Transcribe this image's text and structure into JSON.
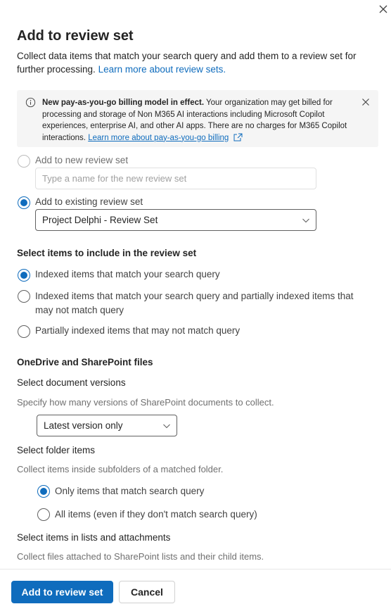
{
  "panel": {
    "title": "Add to review set",
    "description": "Collect data items that match your search query and add them to a review set for further processing.",
    "learn_more_link": "Learn more about review sets."
  },
  "banner": {
    "bold_text": "New pay-as-you-go billing model in effect.",
    "body_text": " Your organization may get billed for processing and storage of Non M365 AI interactions including Microsoft Copilot experiences, enterprise AI, and other AI apps. There are no charges for M365 Copilot interactions. ",
    "link_text": "Learn more about pay-as-you-go billing"
  },
  "review_set": {
    "new_option_label": "Add to new review set",
    "new_name_placeholder": "Type a name for the new review set",
    "existing_option_label": "Add to existing review set",
    "existing_selected": "Project Delphi - Review Set"
  },
  "items_section": {
    "heading": "Select items to include in the review set",
    "options": [
      "Indexed items that match your search query",
      "Indexed items that match your search query and partially indexed items that may not match query",
      "Partially indexed items that may not match query"
    ]
  },
  "onedrive_section": {
    "heading": "OneDrive and SharePoint files",
    "versions_label": "Select document versions",
    "versions_hint": "Specify how many versions of SharePoint documents to collect.",
    "versions_selected": "Latest version only",
    "folder_label": "Select folder items",
    "folder_hint": "Collect items inside subfolders of a matched folder.",
    "folder_options": [
      "Only items that match search query",
      "All items (even if they don't match search query)"
    ],
    "lists_label": "Select items in lists and attachments",
    "lists_hint": "Collect files attached to SharePoint lists and their child items."
  },
  "footer": {
    "primary_label": "Add to review set",
    "cancel_label": "Cancel"
  },
  "colors": {
    "accent": "#0f6cbd",
    "banner_bg": "#f5f5f5"
  }
}
